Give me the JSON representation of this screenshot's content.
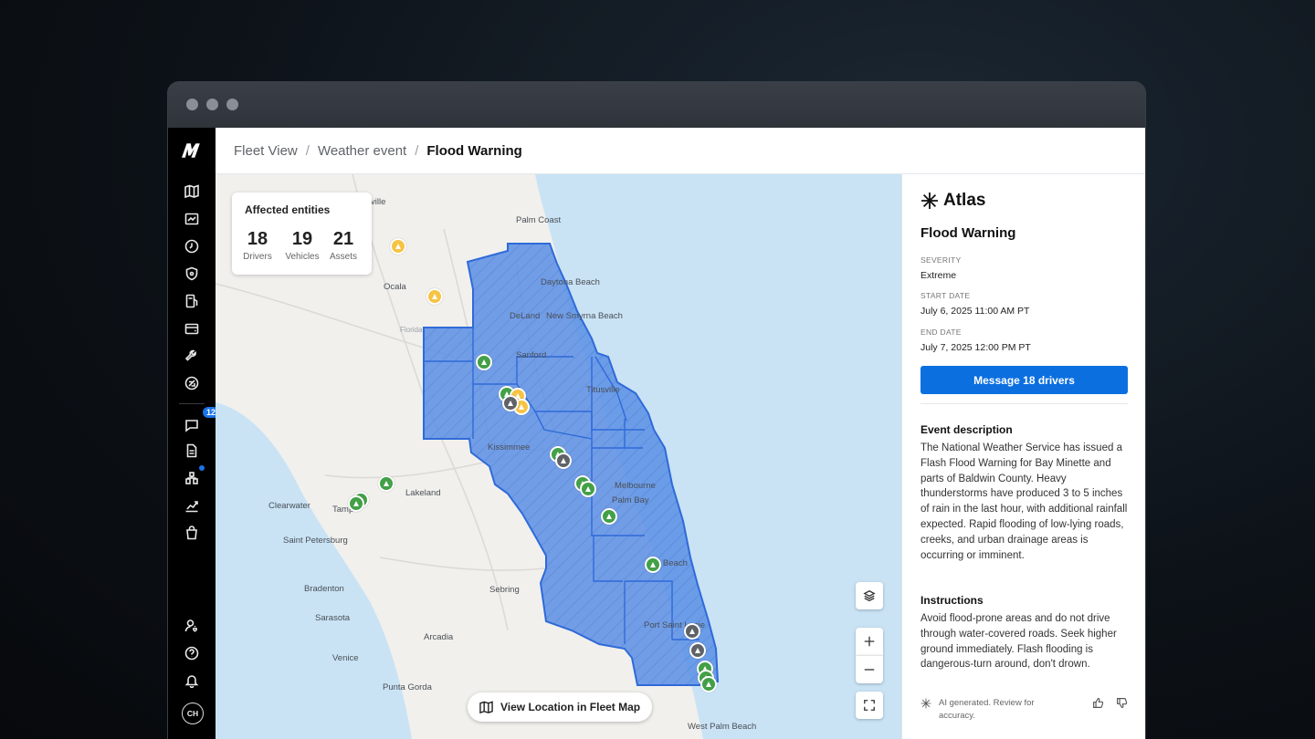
{
  "breadcrumb": {
    "items": [
      "Fleet View",
      "Weather event"
    ],
    "current": "Flood Warning"
  },
  "sidebar": {
    "chat_badge": "12",
    "user_initials": "CH"
  },
  "affected": {
    "title": "Affected entities",
    "stats": [
      {
        "value": "18",
        "label": "Drivers"
      },
      {
        "value": "19",
        "label": "Vehicles"
      },
      {
        "value": "21",
        "label": "Assets"
      }
    ]
  },
  "map": {
    "view_button": "View Location in Fleet Map",
    "cities": [
      "Palm Coast",
      "Daytona Beach",
      "DeLand",
      "New Smyrna Beach",
      "Sanford",
      "Titusville",
      "Kissimmee",
      "Melbourne",
      "Palm Bay",
      "Ocala",
      "Clearwater",
      "Tampa",
      "Lakeland",
      "Saint Petersburg",
      "Bradenton",
      "Sebring",
      "Sarasota",
      "Arcadia",
      "Venice",
      "Punta Gorda",
      "Port Saint Lucie",
      "West Palm Beach",
      "Florida",
      "ville",
      "o Beach"
    ]
  },
  "panel": {
    "brand": "Atlas",
    "title": "Flood Warning",
    "severity_label": "SEVERITY",
    "severity": "Extreme",
    "start_label": "START DATE",
    "start": "July 6, 2025 11:00 AM PT",
    "end_label": "END DATE",
    "end": "July 7, 2025 12:00 PM PT",
    "message_button": "Message 18 drivers",
    "desc_heading": "Event description",
    "description": "The National Weather Service has issued a Flash Flood Warning for Bay Minette and parts of Baldwin County. Heavy thunderstorms have produced 3 to 5 inches of rain in the last hour, with additional rainfall expected. Rapid flooding of low-lying roads, creeks, and urban drainage areas is occurring or imminent.",
    "instr_heading": "Instructions",
    "instructions": "Avoid flood-prone areas and do not drive through water-covered roads. Seek higher ground immediately. Flash flooding is dangerous-turn around, don't drown.",
    "ai_note": "AI generated. Review for accuracy."
  },
  "colors": {
    "accent": "#0b6fe0",
    "flood_fill": "#4a86e8",
    "sidebar": "#000000"
  }
}
